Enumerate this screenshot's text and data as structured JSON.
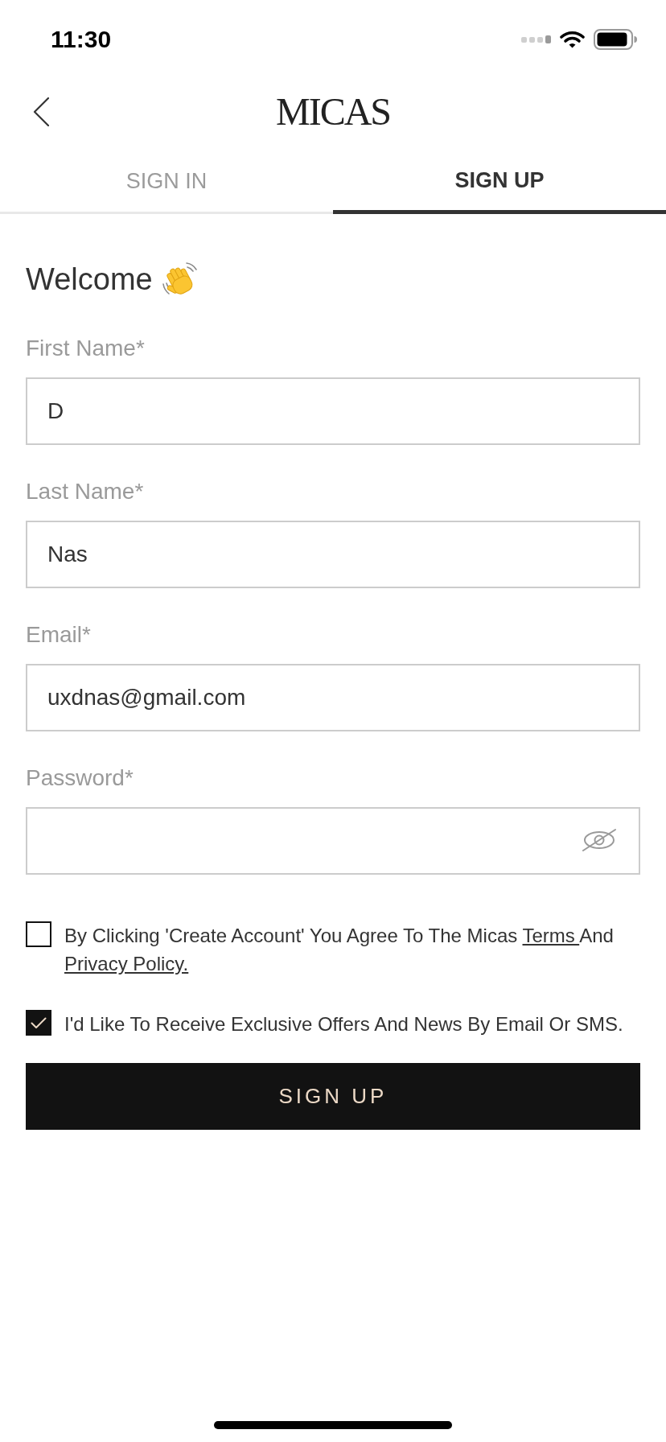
{
  "status_bar": {
    "time": "11:30"
  },
  "header": {
    "logo": "MICAS"
  },
  "tabs": [
    {
      "label": "SIGN IN",
      "selected": false
    },
    {
      "label": "SIGN UP",
      "selected": true
    }
  ],
  "heading": "Welcome",
  "fields": [
    {
      "kind": "text",
      "label": "First Name*",
      "value": "D"
    },
    {
      "kind": "text",
      "label": "Last Name*",
      "value": "Nas"
    },
    {
      "kind": "text",
      "label": "Email*",
      "value": "uxdnas@gmail.com"
    },
    {
      "kind": "password",
      "label": "Password*"
    }
  ],
  "consents": [
    {
      "checked": false,
      "segments": [
        {
          "kind": "text",
          "text": "By Clicking 'Create Account' You Agree To The Micas "
        },
        {
          "kind": "link",
          "text": "Terms "
        },
        {
          "kind": "text",
          "text": "And "
        },
        {
          "kind": "link",
          "text": "Privacy Policy."
        }
      ]
    },
    {
      "checked": true,
      "segments": [
        {
          "kind": "text",
          "text": "I'd Like To Receive Exclusive Offers And News By Email Or SMS."
        }
      ]
    }
  ],
  "submit_button": {
    "label": "SIGN UP"
  }
}
